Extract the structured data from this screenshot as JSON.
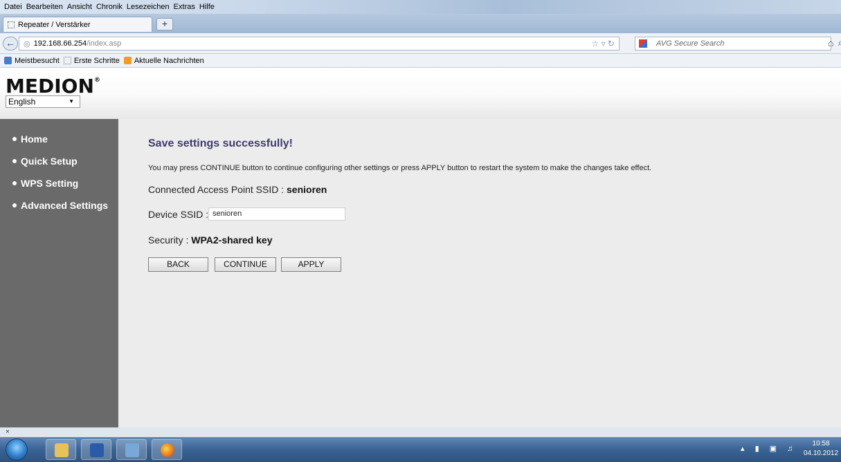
{
  "browser": {
    "menu": [
      "Datei",
      "Bearbeiten",
      "Ansicht",
      "Chronik",
      "Lesezeichen",
      "Extras",
      "Hilfe"
    ],
    "tab_title": "Repeater / Verstärker",
    "new_tab": "+",
    "url_host": "192.168.66.254",
    "url_path": "/index.asp",
    "search_placeholder": "AVG Secure Search",
    "bookmarks": [
      "Meistbesucht",
      "Erste Schritte",
      "Aktuelle Nachrichten"
    ],
    "status_close": "×"
  },
  "header": {
    "logo": "MEDION",
    "logo_mark": "®",
    "language": "English"
  },
  "sidebar": {
    "items": [
      {
        "label": "Home"
      },
      {
        "label": "Quick Setup"
      },
      {
        "label": "WPS Setting"
      },
      {
        "label": "Advanced Settings"
      }
    ]
  },
  "main": {
    "title": "Save settings successfully!",
    "info": "You may press CONTINUE button to continue configuring other settings or press APPLY button to restart the system to make the changes take effect.",
    "connected_label": "Connected Access Point SSID : ",
    "connected_value": "senioren",
    "device_ssid_label": "Device SSID : ",
    "device_ssid_value": "senioren",
    "security_label": "Security : ",
    "security_value": "WPA2-shared key",
    "buttons": {
      "back": "BACK",
      "continue": "CONTINUE",
      "apply": "APPLY"
    }
  },
  "taskbar": {
    "time": "10:58",
    "date": "04.10.2012"
  }
}
